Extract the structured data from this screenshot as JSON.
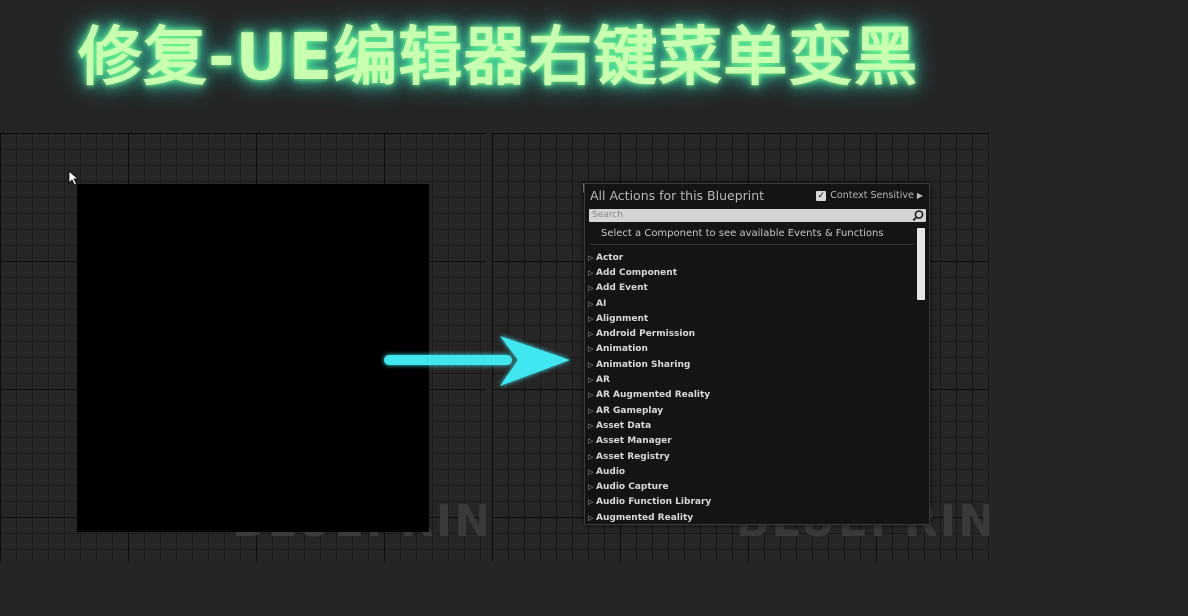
{
  "title": "修复-UE编辑器右键菜单变黑",
  "colors": {
    "title_glow": "#7aff8a",
    "arrow": "#3fe6f0",
    "panel_bg": "#262626",
    "menu_bg": "#141414"
  },
  "left_panel": {
    "watermark": "BLUEPRINT",
    "broken_menu_state": "black (no content rendered)"
  },
  "right_panel": {
    "watermark": "BLUEPRINT",
    "menu": {
      "title": "All Actions for this Blueprint",
      "context_sensitive_label": "Context Sensitive",
      "context_sensitive_checked": true,
      "checkbox_icon": "check-icon",
      "search": {
        "placeholder": "Search",
        "icon": "search-icon"
      },
      "hint": "Select a Component to see available Events & Functions",
      "categories": [
        "Actor",
        "Add Component",
        "Add Event",
        "AI",
        "Alignment",
        "Android Permission",
        "Animation",
        "Animation Sharing",
        "AR",
        "AR Augmented Reality",
        "AR Gameplay",
        "Asset Data",
        "Asset Manager",
        "Asset Registry",
        "Audio",
        "Audio Capture",
        "Audio Function Library",
        "Augmented Reality"
      ]
    }
  },
  "icons": {
    "cursor": "mouse-pointer-icon",
    "arrow": "right-arrow-icon",
    "expand": "triangle-right-icon"
  }
}
